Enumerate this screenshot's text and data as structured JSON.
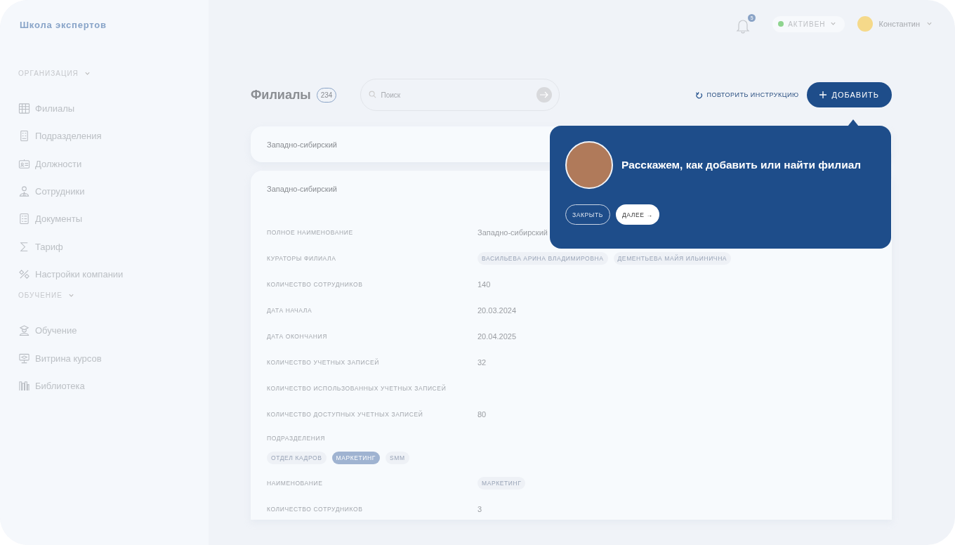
{
  "logo": "Школа экспертов",
  "sidebar": {
    "sections": [
      {
        "title": "ОРГАНИЗАЦИЯ",
        "expanded": true,
        "items": [
          "Филиалы",
          "Подразделения",
          "Должности",
          "Сотрудники",
          "Документы",
          "Тариф",
          "Настройки компании"
        ]
      },
      {
        "title": "ОБУЧЕНИЕ",
        "expanded": true,
        "items": [
          "Обучение",
          "Витрина курсов",
          "Библиотека"
        ]
      }
    ]
  },
  "header": {
    "notifications": "5",
    "status": {
      "label": "АКТИВЕН",
      "color": "#8fd48f"
    },
    "user": "Константин"
  },
  "page": {
    "title": "Филиалы",
    "count": "234",
    "search": {
      "placeholder": "Поиск"
    },
    "repeat_button": "ПОВТОРИТЬ ИНСТРУКЦИЮ",
    "add_button": "ДОБАВИТЬ"
  },
  "branches": [
    {
      "name": "Западно-сибирский",
      "expanded": false
    },
    {
      "name": "Западно-сибирский",
      "expanded": true,
      "fields": [
        {
          "kind": "text",
          "label": "ПОЛНОЕ НАИМЕНОВАНИЕ",
          "value": "Западно-сибирский"
        },
        {
          "kind": "tags",
          "label": "КУРАТОРЫ ФИЛИАЛА",
          "values": [
            "ВАСИЛЬЕВА АРИНА ВЛАДИМИРОВНА",
            "ДЕМЕНТЬЕВА МАЙЯ ИЛЬИНИЧНА"
          ]
        },
        {
          "kind": "text",
          "label": "КОЛИЧЕСТВО СОТРУДНИКОВ",
          "value": "140"
        },
        {
          "kind": "text",
          "label": "ДАТА НАЧАЛА",
          "value": "20.03.2024"
        },
        {
          "kind": "text",
          "label": "ДАТА ОКОНЧАНИЯ",
          "value": "20.04.2025"
        },
        {
          "kind": "text",
          "label": "КОЛИЧЕСТВО УЧЕТНЫХ ЗАПИСЕЙ",
          "value": "32"
        },
        {
          "kind": "empty",
          "label": "КОЛИЧЕСТВО ИСПОЛЬЗОВАННЫХ УЧЕТНЫХ ЗАПИСЕЙ"
        },
        {
          "kind": "text",
          "label": "КОЛИЧЕСТВО ДОСТУПНЫХ УЧЕТНЫХ ЗАПИСЕЙ",
          "value": "80"
        }
      ],
      "subdivisions": {
        "label": "ПОДРАЗДЕЛЕНИЯ",
        "tabs": [
          {
            "label": "ОТДЕЛ КАДРОВ",
            "selected": false
          },
          {
            "label": "МАРКЕТИНГ",
            "selected": true
          },
          {
            "label": "SMM",
            "selected": false
          }
        ],
        "fields": [
          {
            "kind": "tags",
            "label": "НАИМЕНОВАНИЕ",
            "values": [
              "МАРКЕТИНГ"
            ]
          },
          {
            "kind": "text",
            "label": "КОЛИЧЕСТВО СОТРУДНИКОВ",
            "value": "3"
          }
        ]
      }
    }
  ],
  "tour": {
    "text": "Расскажем, как добавить или найти филиал",
    "close_button": "ЗАКРЫТЬ",
    "next_button": "ДАЛЕЕ →"
  }
}
